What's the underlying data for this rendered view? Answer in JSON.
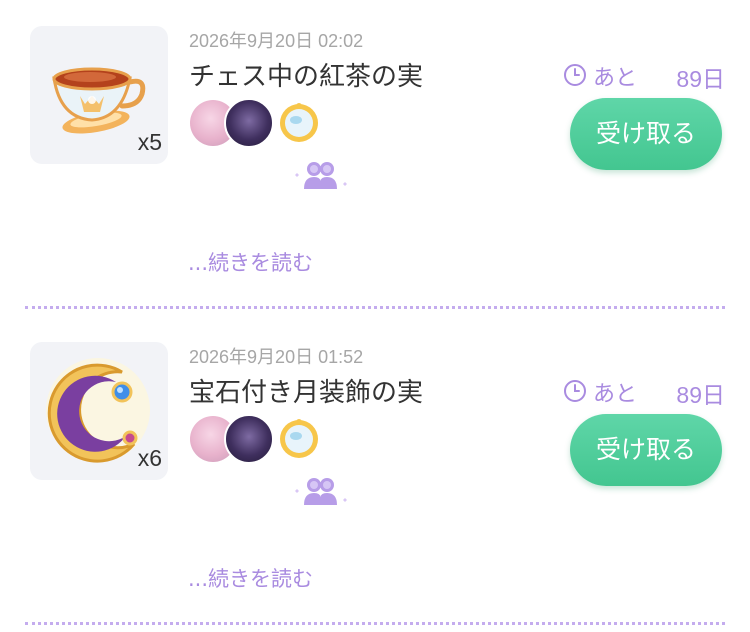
{
  "items": [
    {
      "date": "2026年9月20日 02:02",
      "title": "チェス中の紅茶の実",
      "quantity": "x5",
      "expire_prefix": "あと",
      "expire_days": "89日",
      "claim_label": "受け取る",
      "more_label": "...続きを読む",
      "icon": "teacup-icon"
    },
    {
      "date": "2026年9月20日 01:52",
      "title": "宝石付き月装飾の実",
      "quantity": "x6",
      "expire_prefix": "あと",
      "expire_days": "89日",
      "claim_label": "受け取る",
      "more_label": "...続きを読む",
      "icon": "crescent-moon-icon"
    }
  ],
  "colors": {
    "accent_purple": "#a98be0",
    "button_green": "#4fcc9a",
    "divider": "#c4acee"
  }
}
